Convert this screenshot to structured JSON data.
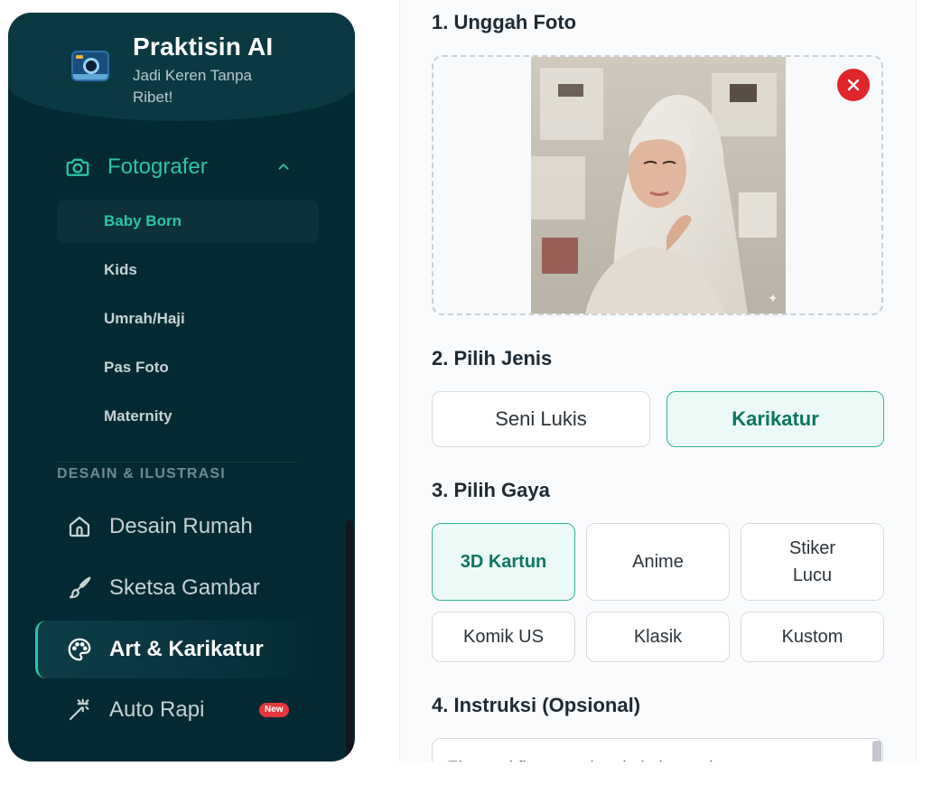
{
  "sidebar": {
    "brand": {
      "title": "Praktisin AI",
      "tagline": "Jadi Keren Tanpa Ribet!"
    },
    "photographer": {
      "label": "Fotografer",
      "items": [
        {
          "label": "Baby Born",
          "active": true
        },
        {
          "label": "Kids"
        },
        {
          "label": "Umrah/Haji"
        },
        {
          "label": "Pas Foto"
        },
        {
          "label": "Maternity"
        }
      ]
    },
    "section_label": "DESAIN & ILUSTRASI",
    "items": [
      {
        "label": "Desain Rumah",
        "icon": "house-icon"
      },
      {
        "label": "Sketsa Gambar",
        "icon": "brush-icon"
      },
      {
        "label": "Art & Karikatur",
        "icon": "palette-icon",
        "active": true
      },
      {
        "label": "Auto Rapi",
        "icon": "magic-wand-icon",
        "badge": "New"
      }
    ]
  },
  "main": {
    "upload": {
      "heading": "1. Unggah Foto"
    },
    "type": {
      "heading": "2. Pilih Jenis",
      "options": [
        "Seni Lukis",
        "Karikatur"
      ],
      "selected": "Karikatur"
    },
    "style": {
      "heading": "3. Pilih Gaya",
      "options": [
        "3D Kartun",
        "Anime",
        "Stiker Lucu",
        "Komik US",
        "Klasik",
        "Kustom"
      ],
      "selected": "3D Kartun"
    },
    "instructions": {
      "heading": "4. Instruksi (Opsional)",
      "value": "Ekspresi fine-tuned, pakai ekspresi tersenyum"
    }
  },
  "colors": {
    "sidebar_bg": "#032a33",
    "accent": "#2cc5a6",
    "selected_bg": "#ebfaf6",
    "danger": "#e0252b"
  }
}
